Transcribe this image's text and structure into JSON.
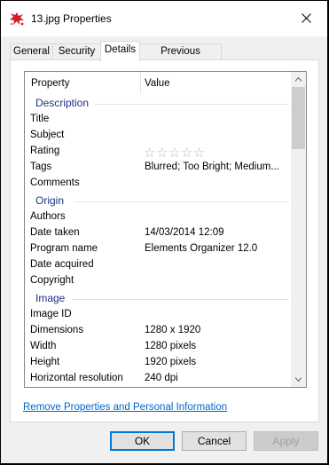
{
  "window": {
    "title": "13.jpg Properties",
    "icon": "paint-splat-icon",
    "close_icon": "close-icon"
  },
  "tabs": [
    "General",
    "Security",
    "Details",
    "Previous Versions"
  ],
  "active_tab": "Details",
  "columns": {
    "property": "Property",
    "value": "Value"
  },
  "groups": [
    {
      "label": "Description",
      "rows": [
        {
          "key": "Title",
          "value": ""
        },
        {
          "key": "Subject",
          "value": ""
        },
        {
          "key": "Rating",
          "value": "",
          "stars": 5,
          "rating": 0
        },
        {
          "key": "Tags",
          "value": "Blurred; Too Bright; Medium..."
        },
        {
          "key": "Comments",
          "value": ""
        }
      ]
    },
    {
      "label": "Origin",
      "rows": [
        {
          "key": "Authors",
          "value": ""
        },
        {
          "key": "Date taken",
          "value": "14/03/2014 12:09"
        },
        {
          "key": "Program name",
          "value": "Elements Organizer 12.0"
        },
        {
          "key": "Date acquired",
          "value": ""
        },
        {
          "key": "Copyright",
          "value": ""
        }
      ]
    },
    {
      "label": "Image",
      "rows": [
        {
          "key": "Image ID",
          "value": ""
        },
        {
          "key": "Dimensions",
          "value": "1280 x 1920"
        },
        {
          "key": "Width",
          "value": "1280 pixels"
        },
        {
          "key": "Height",
          "value": "1920 pixels"
        },
        {
          "key": "Horizontal resolution",
          "value": "240 dpi"
        }
      ]
    }
  ],
  "remove_link": "Remove Properties and Personal Information",
  "buttons": {
    "ok": "OK",
    "cancel": "Cancel",
    "apply": "Apply"
  },
  "colors": {
    "group_heading": "#1e3287",
    "link": "#0066cc",
    "ok_border": "#0078d7"
  }
}
